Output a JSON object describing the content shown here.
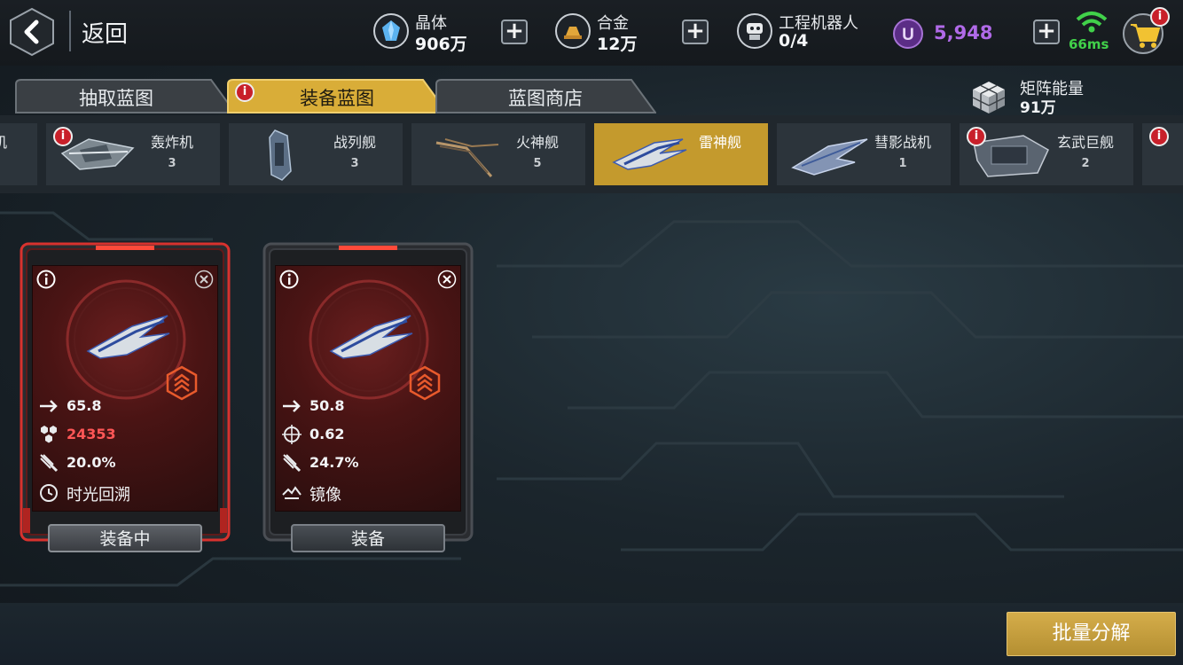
{
  "header": {
    "back_label": "返回",
    "resources": [
      {
        "name": "晶体",
        "value": "906万",
        "icon": "crystal-icon"
      },
      {
        "name": "合金",
        "value": "12万",
        "icon": "alloy-icon"
      },
      {
        "name": "工程机器人",
        "value": "0/4",
        "icon": "robot-icon"
      }
    ],
    "currency_value": "5,948",
    "ping": "66ms"
  },
  "tabs": [
    {
      "label": "抽取蓝图",
      "active": false,
      "alert": false
    },
    {
      "label": "装备蓝图",
      "active": true,
      "alert": true
    },
    {
      "label": "蓝图商店",
      "active": false,
      "alert": false
    }
  ],
  "matrix": {
    "name": "矩阵能量",
    "value": "91万"
  },
  "ships": [
    {
      "name": "轰炸机",
      "count": "3",
      "alert": true,
      "active": false
    },
    {
      "name": "战列舰",
      "count": "3",
      "alert": false,
      "active": false
    },
    {
      "name": "火神舰",
      "count": "5",
      "alert": false,
      "active": false
    },
    {
      "name": "雷神舰",
      "count": "",
      "alert": false,
      "active": true
    },
    {
      "name": "彗影战机",
      "count": "1",
      "alert": false,
      "active": false
    },
    {
      "name": "玄武巨舰",
      "count": "2",
      "alert": true,
      "active": false
    }
  ],
  "cards": [
    {
      "speed": "65.8",
      "stat2": "24353",
      "stat3": "20.0%",
      "skill": "时光回溯",
      "button": "装备中"
    },
    {
      "speed": "50.8",
      "stat2": "0.62",
      "stat3": "24.7%",
      "skill": "镜像",
      "button": "装备"
    }
  ],
  "batch_button": "批量分解",
  "colors": {
    "accent_gold": "#c49a2d",
    "alert_red": "#c8202a",
    "currency_purple": "#b06ae8",
    "ping_green": "#41d14a"
  }
}
